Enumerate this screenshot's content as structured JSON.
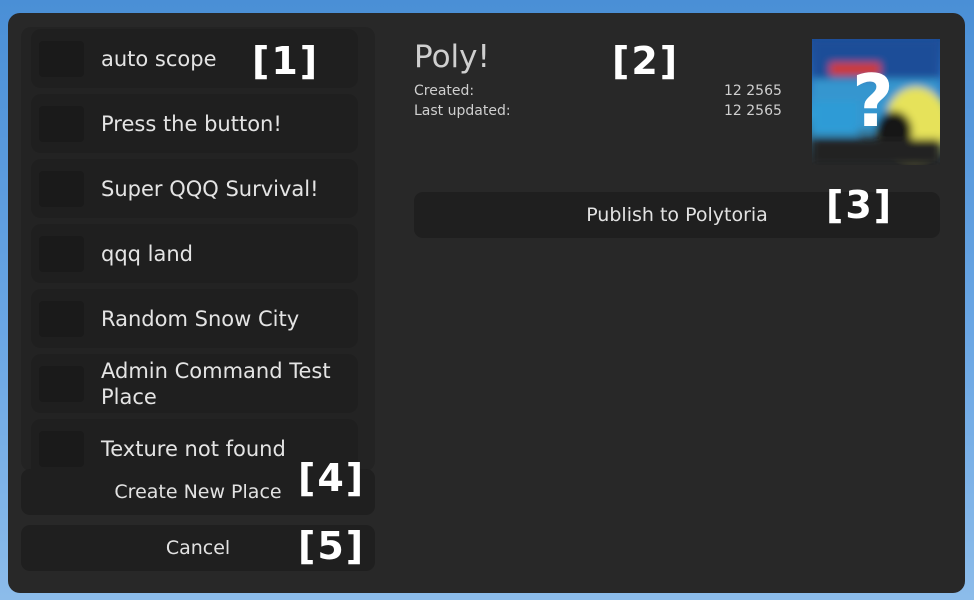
{
  "places": [
    {
      "name": "auto scope"
    },
    {
      "name": "Press the button!"
    },
    {
      "name": "Super QQQ Survival!"
    },
    {
      "name": "qqq land"
    },
    {
      "name": "Random Snow City"
    },
    {
      "name": "Admin Command Test Place"
    },
    {
      "name": "Texture not found"
    }
  ],
  "detail": {
    "title": "Poly!",
    "created_label": "Created:",
    "created_value": "12  2565",
    "updated_label": "Last updated:",
    "updated_value": "12  2565",
    "thumbnail_icon": "question-mark-icon",
    "thumbnail_glyph": "?",
    "publish_label": "Publish to Polytoria"
  },
  "actions": {
    "create_label": "Create New Place",
    "cancel_label": "Cancel"
  },
  "markers": {
    "m1": "[1]",
    "m2": "[2]",
    "m3": "[3]",
    "m4": "[4]",
    "m5": "[5]"
  },
  "colors": {
    "dialog_bg": "#282828",
    "item_bg": "#1f1f1f",
    "text": "#e4e4e4"
  }
}
